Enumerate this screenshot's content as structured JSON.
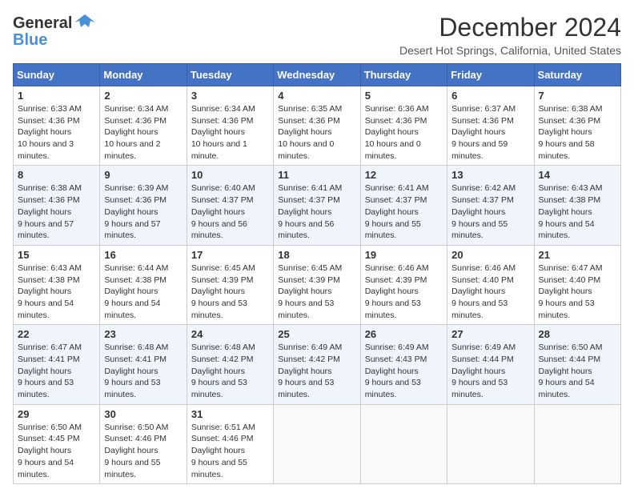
{
  "header": {
    "logo_general": "General",
    "logo_blue": "Blue",
    "month_title": "December 2024",
    "location": "Desert Hot Springs, California, United States"
  },
  "days_of_week": [
    "Sunday",
    "Monday",
    "Tuesday",
    "Wednesday",
    "Thursday",
    "Friday",
    "Saturday"
  ],
  "weeks": [
    [
      {
        "day": "1",
        "sunrise": "Sunrise: 6:33 AM",
        "sunset": "Sunset: 4:36 PM",
        "daylight": "Daylight: 10 hours and 3 minutes."
      },
      {
        "day": "2",
        "sunrise": "Sunrise: 6:34 AM",
        "sunset": "Sunset: 4:36 PM",
        "daylight": "Daylight: 10 hours and 2 minutes."
      },
      {
        "day": "3",
        "sunrise": "Sunrise: 6:34 AM",
        "sunset": "Sunset: 4:36 PM",
        "daylight": "Daylight: 10 hours and 1 minute."
      },
      {
        "day": "4",
        "sunrise": "Sunrise: 6:35 AM",
        "sunset": "Sunset: 4:36 PM",
        "daylight": "Daylight: 10 hours and 0 minutes."
      },
      {
        "day": "5",
        "sunrise": "Sunrise: 6:36 AM",
        "sunset": "Sunset: 4:36 PM",
        "daylight": "Daylight: 10 hours and 0 minutes."
      },
      {
        "day": "6",
        "sunrise": "Sunrise: 6:37 AM",
        "sunset": "Sunset: 4:36 PM",
        "daylight": "Daylight: 9 hours and 59 minutes."
      },
      {
        "day": "7",
        "sunrise": "Sunrise: 6:38 AM",
        "sunset": "Sunset: 4:36 PM",
        "daylight": "Daylight: 9 hours and 58 minutes."
      }
    ],
    [
      {
        "day": "8",
        "sunrise": "Sunrise: 6:38 AM",
        "sunset": "Sunset: 4:36 PM",
        "daylight": "Daylight: 9 hours and 57 minutes."
      },
      {
        "day": "9",
        "sunrise": "Sunrise: 6:39 AM",
        "sunset": "Sunset: 4:36 PM",
        "daylight": "Daylight: 9 hours and 57 minutes."
      },
      {
        "day": "10",
        "sunrise": "Sunrise: 6:40 AM",
        "sunset": "Sunset: 4:37 PM",
        "daylight": "Daylight: 9 hours and 56 minutes."
      },
      {
        "day": "11",
        "sunrise": "Sunrise: 6:41 AM",
        "sunset": "Sunset: 4:37 PM",
        "daylight": "Daylight: 9 hours and 56 minutes."
      },
      {
        "day": "12",
        "sunrise": "Sunrise: 6:41 AM",
        "sunset": "Sunset: 4:37 PM",
        "daylight": "Daylight: 9 hours and 55 minutes."
      },
      {
        "day": "13",
        "sunrise": "Sunrise: 6:42 AM",
        "sunset": "Sunset: 4:37 PM",
        "daylight": "Daylight: 9 hours and 55 minutes."
      },
      {
        "day": "14",
        "sunrise": "Sunrise: 6:43 AM",
        "sunset": "Sunset: 4:38 PM",
        "daylight": "Daylight: 9 hours and 54 minutes."
      }
    ],
    [
      {
        "day": "15",
        "sunrise": "Sunrise: 6:43 AM",
        "sunset": "Sunset: 4:38 PM",
        "daylight": "Daylight: 9 hours and 54 minutes."
      },
      {
        "day": "16",
        "sunrise": "Sunrise: 6:44 AM",
        "sunset": "Sunset: 4:38 PM",
        "daylight": "Daylight: 9 hours and 54 minutes."
      },
      {
        "day": "17",
        "sunrise": "Sunrise: 6:45 AM",
        "sunset": "Sunset: 4:39 PM",
        "daylight": "Daylight: 9 hours and 53 minutes."
      },
      {
        "day": "18",
        "sunrise": "Sunrise: 6:45 AM",
        "sunset": "Sunset: 4:39 PM",
        "daylight": "Daylight: 9 hours and 53 minutes."
      },
      {
        "day": "19",
        "sunrise": "Sunrise: 6:46 AM",
        "sunset": "Sunset: 4:39 PM",
        "daylight": "Daylight: 9 hours and 53 minutes."
      },
      {
        "day": "20",
        "sunrise": "Sunrise: 6:46 AM",
        "sunset": "Sunset: 4:40 PM",
        "daylight": "Daylight: 9 hours and 53 minutes."
      },
      {
        "day": "21",
        "sunrise": "Sunrise: 6:47 AM",
        "sunset": "Sunset: 4:40 PM",
        "daylight": "Daylight: 9 hours and 53 minutes."
      }
    ],
    [
      {
        "day": "22",
        "sunrise": "Sunrise: 6:47 AM",
        "sunset": "Sunset: 4:41 PM",
        "daylight": "Daylight: 9 hours and 53 minutes."
      },
      {
        "day": "23",
        "sunrise": "Sunrise: 6:48 AM",
        "sunset": "Sunset: 4:41 PM",
        "daylight": "Daylight: 9 hours and 53 minutes."
      },
      {
        "day": "24",
        "sunrise": "Sunrise: 6:48 AM",
        "sunset": "Sunset: 4:42 PM",
        "daylight": "Daylight: 9 hours and 53 minutes."
      },
      {
        "day": "25",
        "sunrise": "Sunrise: 6:49 AM",
        "sunset": "Sunset: 4:42 PM",
        "daylight": "Daylight: 9 hours and 53 minutes."
      },
      {
        "day": "26",
        "sunrise": "Sunrise: 6:49 AM",
        "sunset": "Sunset: 4:43 PM",
        "daylight": "Daylight: 9 hours and 53 minutes."
      },
      {
        "day": "27",
        "sunrise": "Sunrise: 6:49 AM",
        "sunset": "Sunset: 4:44 PM",
        "daylight": "Daylight: 9 hours and 53 minutes."
      },
      {
        "day": "28",
        "sunrise": "Sunrise: 6:50 AM",
        "sunset": "Sunset: 4:44 PM",
        "daylight": "Daylight: 9 hours and 54 minutes."
      }
    ],
    [
      {
        "day": "29",
        "sunrise": "Sunrise: 6:50 AM",
        "sunset": "Sunset: 4:45 PM",
        "daylight": "Daylight: 9 hours and 54 minutes."
      },
      {
        "day": "30",
        "sunrise": "Sunrise: 6:50 AM",
        "sunset": "Sunset: 4:46 PM",
        "daylight": "Daylight: 9 hours and 55 minutes."
      },
      {
        "day": "31",
        "sunrise": "Sunrise: 6:51 AM",
        "sunset": "Sunset: 4:46 PM",
        "daylight": "Daylight: 9 hours and 55 minutes."
      },
      null,
      null,
      null,
      null
    ]
  ]
}
